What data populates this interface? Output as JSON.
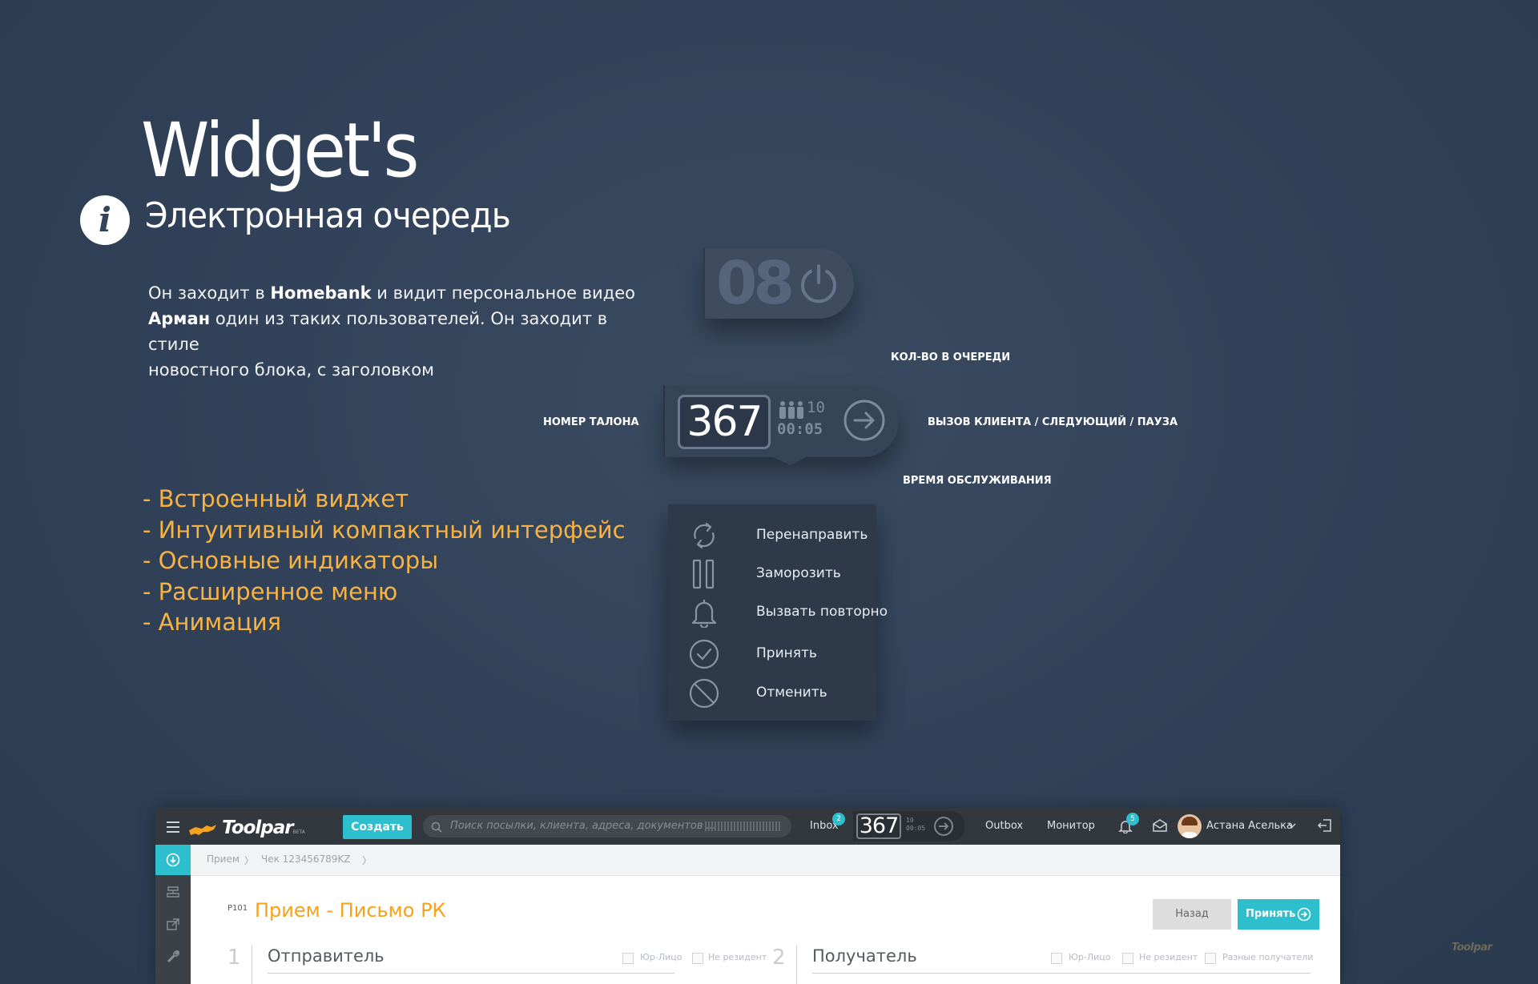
{
  "header": {
    "title": "Widget's",
    "subtitle": "Электронная очередь",
    "info_icon": "i"
  },
  "description": {
    "line1_pre": "Он заходит в ",
    "line1_bold": "Homebank",
    "line1_post": " и видит персональное видео",
    "line2_bold": "Арман",
    "line2_post": " один из таких пользователей. Он заходит в стиле",
    "line3": "новостного блока, с заголовком"
  },
  "features": [
    "- Встроенный виджет",
    "- Интуитивный  компактный интерфейс",
    "- Основные индикаторы",
    "- Расширенное меню",
    "- Анимация"
  ],
  "widget_small": {
    "number": "08",
    "icon": "power-icon"
  },
  "widget_main": {
    "ticket": "367",
    "queue_count": "10",
    "service_time": "00:05",
    "people_icon": "people-icon",
    "action_icon": "arrow-right-icon"
  },
  "callouts": {
    "queue_count": "КОЛ-ВО В ОЧЕРЕДИ",
    "ticket_number": "НОМЕР ТАЛОНА",
    "call_client": "ВЫЗОВ КЛИЕНТА / СЛЕДУЮЩИЙ / ПАУЗА",
    "service_time": "ВРЕМЯ ОБСЛУЖИВАНИЯ"
  },
  "menu": {
    "items": [
      {
        "label": "Перенаправить",
        "icon": "redirect-icon"
      },
      {
        "label": "Заморозить",
        "icon": "pause-icon"
      },
      {
        "label": "Вызвать повторно",
        "icon": "bell-icon"
      },
      {
        "label": "Принять",
        "icon": "check-icon"
      },
      {
        "label": "Отменить",
        "icon": "cancel-icon"
      }
    ]
  },
  "app": {
    "logo": "Toolpar",
    "logo_beta": "BETA",
    "create_label": "Создать",
    "search_placeholder": "Поиск посылки, клиента, адреса, документов ...",
    "inbox_label": "Inbox",
    "inbox_badge": "2",
    "mini_widget": {
      "ticket": "367",
      "count": "10",
      "time": "00:05"
    },
    "outbox_label": "Outbox",
    "monitor_label": "Монитор",
    "notifications_badge": "5",
    "user_name": "Астана Аселька",
    "breadcrumbs": [
      "Прием",
      "Чек 123456789KZ"
    ],
    "form": {
      "code": "P101",
      "title": "Прием - Письмо РК",
      "back_label": "Назад",
      "accept_label": "Принять",
      "section1_num": "1",
      "section1_title": "Отправитель",
      "section2_num": "2",
      "section2_title": "Получатель",
      "cb_legal": "Юр-Лицо",
      "cb_nonresident": "Не резидент",
      "cb_multiple": "Разные получатели"
    }
  },
  "watermark": "Toolpar",
  "colors": {
    "accent": "#2dbfce",
    "orange": "#f6b344",
    "title_orange": "#f6a21c",
    "bg": "#32425a"
  }
}
